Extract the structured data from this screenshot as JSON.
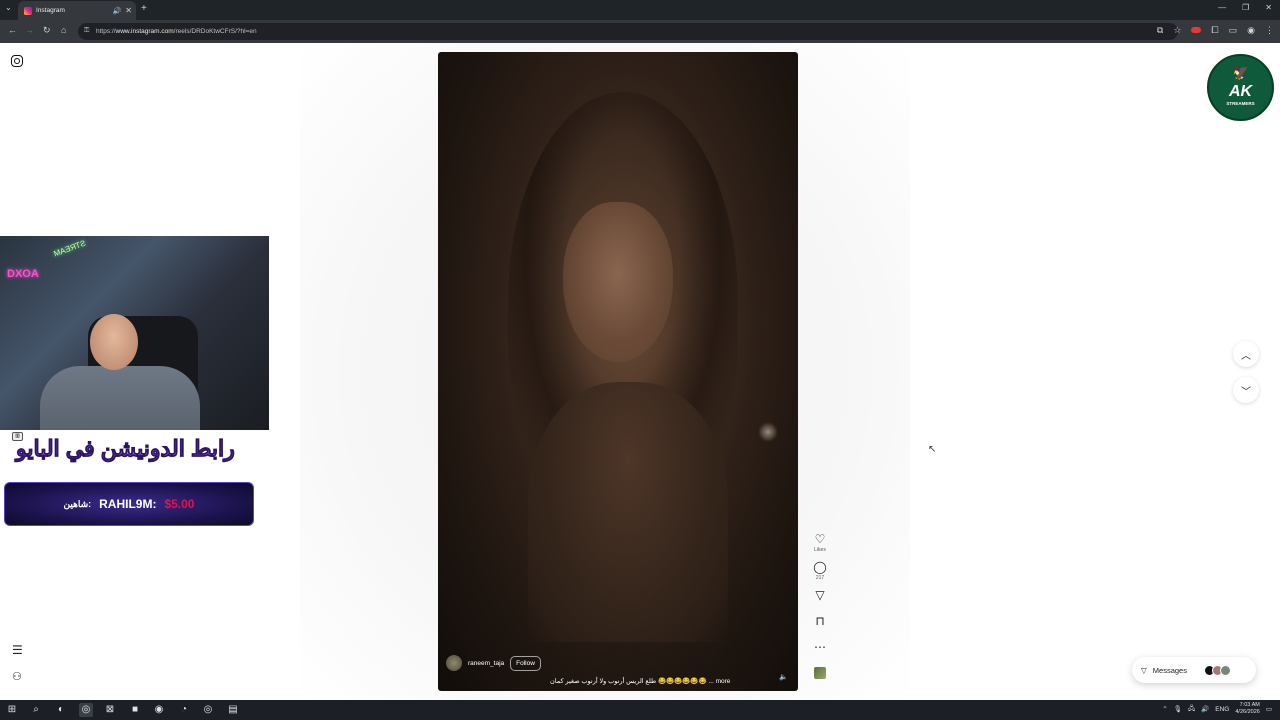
{
  "browser": {
    "tab_title": "Instagram",
    "url_prefix": "https://",
    "url_host": "www.instagram.com",
    "url_path": "/reels/DRDoKtwCFrS/?hl=en"
  },
  "reel": {
    "username": "raneem_taja",
    "follow_label": "Follow",
    "caption": "طلع الريس أرنوب ولا أرنوب صغير كمان 😂😂😂😂😂😂 ... more",
    "likes_label": "Likes",
    "comments_count": "217"
  },
  "messages": {
    "label": "Messages"
  },
  "stream": {
    "neon_sign": "DXOA",
    "overlay_title": "رابط الدونيشن في البايو",
    "donor_arabic": "شاهين:",
    "donor_name": "RAHIL9M:",
    "donor_amount": "$5.00"
  },
  "logo": {
    "brand": "AK",
    "sub": "STREAMERS"
  },
  "taskbar": {
    "lang": "ENG",
    "time": "7:03 AM",
    "date": "4/26/2026"
  },
  "colors": {
    "accent_stream": "#a77bff",
    "donation_red": "#e3124a",
    "brand_green": "#0e5a3a"
  }
}
